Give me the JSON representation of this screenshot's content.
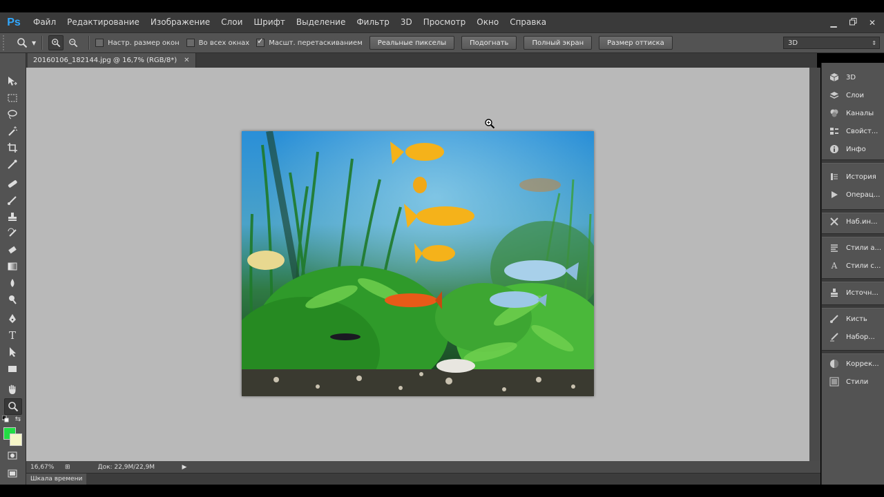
{
  "app": {
    "logo": "Ps"
  },
  "menu": [
    "Файл",
    "Редактирование",
    "Изображение",
    "Слои",
    "Шрифт",
    "Выделение",
    "Фильтр",
    "3D",
    "Просмотр",
    "Окно",
    "Справка"
  ],
  "window_controls": [
    "minimize-icon",
    "restore-icon",
    "close-icon"
  ],
  "options": {
    "checkboxes": [
      {
        "label": "Настр. размер окон",
        "checked": false
      },
      {
        "label": "Во всех окнах",
        "checked": false
      },
      {
        "label": "Масшт. перетаскиванием",
        "checked": true
      }
    ],
    "buttons": [
      "Реальные пикселы",
      "Подогнать",
      "Полный экран",
      "Размер оттиска"
    ],
    "workspace": "3D"
  },
  "document": {
    "tab_title": "20160106_182144.jpg @ 16,7% (RGB/8*)"
  },
  "status": {
    "zoom": "16,67%",
    "doc_size": "Док: 22,9M/22,9M"
  },
  "timeline": {
    "label": "Шкала времени"
  },
  "colors": {
    "foreground": "#22dd44",
    "background": "#f6f6c8",
    "accent": "#31a8ff"
  },
  "panels": {
    "group1": [
      {
        "label": "3D",
        "icon": "cube-icon"
      },
      {
        "label": "Слои",
        "icon": "layers-icon"
      },
      {
        "label": "Каналы",
        "icon": "channels-icon"
      },
      {
        "label": "Свойст...",
        "icon": "properties-icon"
      },
      {
        "label": "Инфо",
        "icon": "info-icon"
      }
    ],
    "group2": [
      {
        "label": "История",
        "icon": "history-icon"
      },
      {
        "label": "Операц...",
        "icon": "actions-icon"
      }
    ],
    "group3": [
      {
        "label": "Наб.ин...",
        "icon": "tool-presets-icon"
      }
    ],
    "group4": [
      {
        "label": "Стили а...",
        "icon": "paragraph-styles-icon"
      },
      {
        "label": "Стили с...",
        "icon": "character-styles-icon"
      }
    ],
    "group5": [
      {
        "label": "Источн...",
        "icon": "clone-source-icon"
      }
    ],
    "group6": [
      {
        "label": "Кисть",
        "icon": "brush-icon"
      },
      {
        "label": "Набор...",
        "icon": "brush-presets-icon"
      }
    ],
    "group7": [
      {
        "label": "Коррек...",
        "icon": "adjustments-icon"
      },
      {
        "label": "Стили",
        "icon": "styles-icon"
      }
    ]
  }
}
